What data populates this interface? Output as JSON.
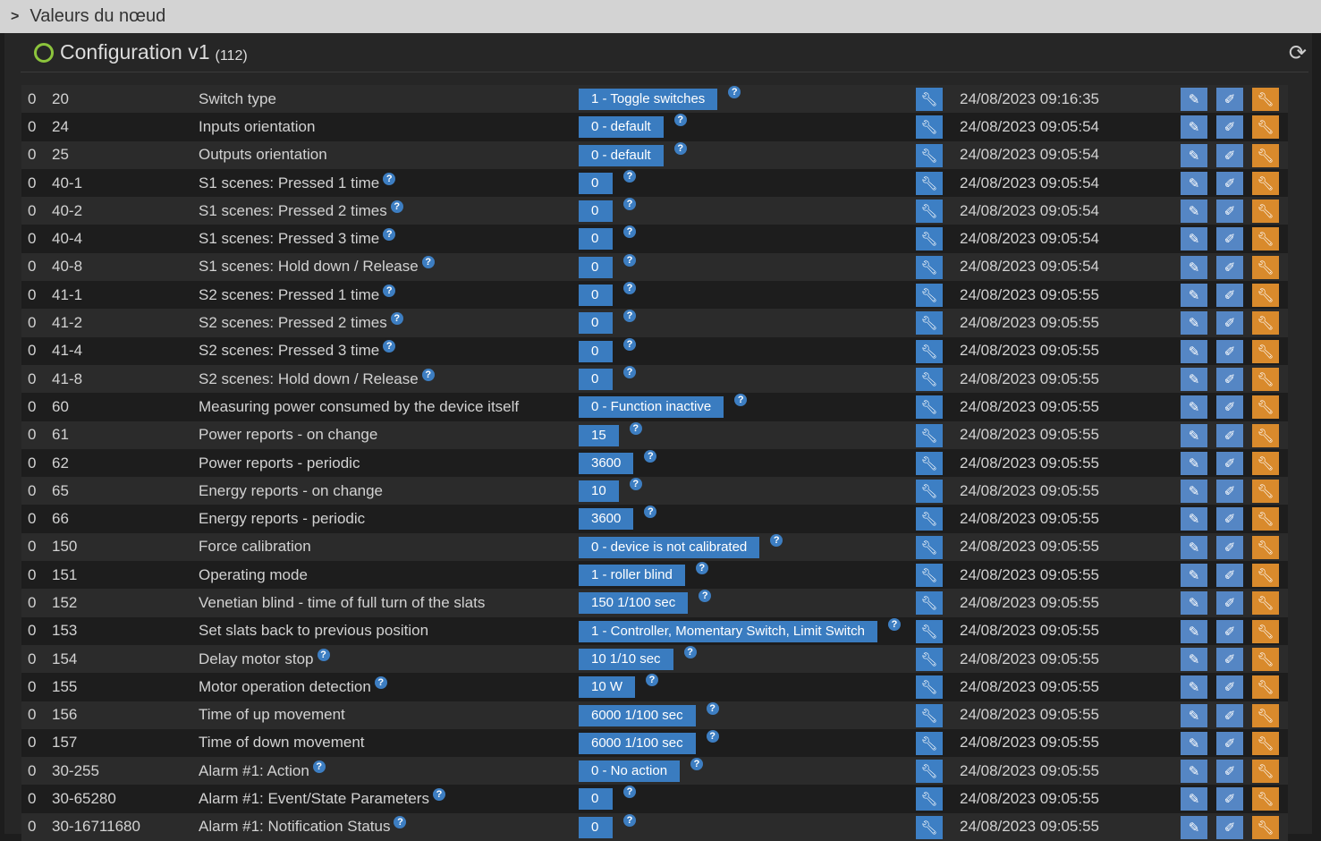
{
  "header": {
    "title": "Valeurs du nœud"
  },
  "panel": {
    "title": "Configuration v1",
    "count": "(112)"
  },
  "colors": {
    "accent": "#3d7fc4",
    "orange": "#d98a2c",
    "ring": "#8cc43c"
  },
  "rows": [
    {
      "inst": "0",
      "id": "20",
      "name": "Switch type",
      "name_help": false,
      "value": "1 - Toggle switches",
      "time": "24/08/2023 09:16:35"
    },
    {
      "inst": "0",
      "id": "24",
      "name": "Inputs orientation",
      "name_help": false,
      "value": "0 - default",
      "time": "24/08/2023 09:05:54"
    },
    {
      "inst": "0",
      "id": "25",
      "name": "Outputs orientation",
      "name_help": false,
      "value": "0 - default",
      "time": "24/08/2023 09:05:54"
    },
    {
      "inst": "0",
      "id": "40-1",
      "name": "S1 scenes: Pressed 1 time",
      "name_help": true,
      "value": "0",
      "time": "24/08/2023 09:05:54"
    },
    {
      "inst": "0",
      "id": "40-2",
      "name": "S1 scenes: Pressed 2 times",
      "name_help": true,
      "value": "0",
      "time": "24/08/2023 09:05:54"
    },
    {
      "inst": "0",
      "id": "40-4",
      "name": "S1 scenes: Pressed 3 time",
      "name_help": true,
      "value": "0",
      "time": "24/08/2023 09:05:54"
    },
    {
      "inst": "0",
      "id": "40-8",
      "name": "S1 scenes: Hold down / Release",
      "name_help": true,
      "value": "0",
      "time": "24/08/2023 09:05:54"
    },
    {
      "inst": "0",
      "id": "41-1",
      "name": "S2 scenes: Pressed 1 time",
      "name_help": true,
      "value": "0",
      "time": "24/08/2023 09:05:55"
    },
    {
      "inst": "0",
      "id": "41-2",
      "name": "S2 scenes: Pressed 2 times",
      "name_help": true,
      "value": "0",
      "time": "24/08/2023 09:05:55"
    },
    {
      "inst": "0",
      "id": "41-4",
      "name": "S2 scenes: Pressed 3 time",
      "name_help": true,
      "value": "0",
      "time": "24/08/2023 09:05:55"
    },
    {
      "inst": "0",
      "id": "41-8",
      "name": "S2 scenes: Hold down / Release",
      "name_help": true,
      "value": "0",
      "time": "24/08/2023 09:05:55"
    },
    {
      "inst": "0",
      "id": "60",
      "name": "Measuring power consumed by the device itself",
      "name_help": false,
      "value": "0 - Function inactive",
      "time": "24/08/2023 09:05:55"
    },
    {
      "inst": "0",
      "id": "61",
      "name": "Power reports - on change",
      "name_help": false,
      "value": "15",
      "time": "24/08/2023 09:05:55"
    },
    {
      "inst": "0",
      "id": "62",
      "name": "Power reports - periodic",
      "name_help": false,
      "value": "3600",
      "time": "24/08/2023 09:05:55"
    },
    {
      "inst": "0",
      "id": "65",
      "name": "Energy reports - on change",
      "name_help": false,
      "value": "10",
      "time": "24/08/2023 09:05:55"
    },
    {
      "inst": "0",
      "id": "66",
      "name": "Energy reports - periodic",
      "name_help": false,
      "value": "3600",
      "time": "24/08/2023 09:05:55"
    },
    {
      "inst": "0",
      "id": "150",
      "name": "Force calibration",
      "name_help": false,
      "value": "0 - device is not calibrated",
      "time": "24/08/2023 09:05:55"
    },
    {
      "inst": "0",
      "id": "151",
      "name": "Operating mode",
      "name_help": false,
      "value": "1 - roller blind",
      "time": "24/08/2023 09:05:55"
    },
    {
      "inst": "0",
      "id": "152",
      "name": "Venetian blind - time of full turn of the slats",
      "name_help": false,
      "value": "150 1/100 sec",
      "time": "24/08/2023 09:05:55"
    },
    {
      "inst": "0",
      "id": "153",
      "name": "Set slats back to previous position",
      "name_help": false,
      "value": "1 - Controller, Momentary Switch, Limit Switch",
      "time": "24/08/2023 09:05:55"
    },
    {
      "inst": "0",
      "id": "154",
      "name": "Delay motor stop",
      "name_help": true,
      "value": "10 1/10 sec",
      "time": "24/08/2023 09:05:55"
    },
    {
      "inst": "0",
      "id": "155",
      "name": "Motor operation detection",
      "name_help": true,
      "value": "10 W",
      "time": "24/08/2023 09:05:55"
    },
    {
      "inst": "0",
      "id": "156",
      "name": "Time of up movement",
      "name_help": false,
      "value": "6000 1/100 sec",
      "time": "24/08/2023 09:05:55"
    },
    {
      "inst": "0",
      "id": "157",
      "name": "Time of down movement",
      "name_help": false,
      "value": "6000 1/100 sec",
      "time": "24/08/2023 09:05:55"
    },
    {
      "inst": "0",
      "id": "30-255",
      "name": "Alarm #1: Action",
      "name_help": true,
      "value": "0 - No action",
      "time": "24/08/2023 09:05:55"
    },
    {
      "inst": "0",
      "id": "30-65280",
      "name": "Alarm #1: Event/State Parameters",
      "name_help": true,
      "value": "0",
      "time": "24/08/2023 09:05:55"
    },
    {
      "inst": "0",
      "id": "30-16711680",
      "name": "Alarm #1: Notification Status",
      "name_help": true,
      "value": "0",
      "time": "24/08/2023 09:05:55"
    }
  ]
}
